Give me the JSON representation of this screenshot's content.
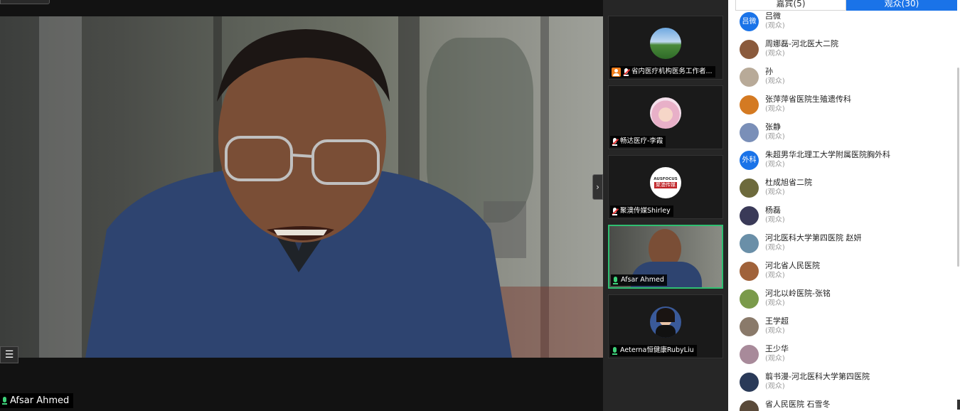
{
  "main": {
    "speaker_name": "Afsar Ahmed",
    "top_button_label": "",
    "list_button_icon": "list-icon",
    "collapse_icon": "chevron-right-icon"
  },
  "thumbnails": [
    {
      "label": "省内医疗机构医务工作者...",
      "host": true,
      "mic": "muted",
      "avatar": "landscape-photo"
    },
    {
      "label": "畅达医疗-李霞",
      "host": false,
      "mic": "muted",
      "avatar": "anime-girl"
    },
    {
      "label": "聚澳传媒Shirley",
      "host": false,
      "mic": "muted",
      "avatar": "logo",
      "logo_top": "AUSFOCUS",
      "logo_bottom": "聚澳传媒"
    },
    {
      "label": "Afsar Ahmed",
      "host": false,
      "mic": "active",
      "avatar": "video",
      "active": true
    },
    {
      "label": "Aeterna恒健康RubyLiu",
      "host": false,
      "mic": "active",
      "avatar": "woman-photo"
    }
  ],
  "panel": {
    "tabs": [
      {
        "label": "嘉宾(5)",
        "active": false
      },
      {
        "label": "观众(30)",
        "active": true
      }
    ],
    "attendees": [
      {
        "name": "吕微",
        "role": "(观众)",
        "avatar_text": "吕微",
        "color": "#1a73e8"
      },
      {
        "name": "周娜磊-河北医大二院",
        "role": "(观众)",
        "avatar_text": "",
        "color": "#8a5a3c"
      },
      {
        "name": "孙",
        "role": "(观众)",
        "avatar_text": "",
        "color": "#b8aa98"
      },
      {
        "name": "张萍萍省医院生殖遗传科",
        "role": "(观众)",
        "avatar_text": "",
        "color": "#d47a22"
      },
      {
        "name": "张静",
        "role": "(观众)",
        "avatar_text": "",
        "color": "#7a8fb8"
      },
      {
        "name": "朱超男华北理工大学附属医院胸外科",
        "role": "(观众)",
        "avatar_text": "外科",
        "color": "#1a73e8"
      },
      {
        "name": "杜成旭省二院",
        "role": "(观众)",
        "avatar_text": "",
        "color": "#6d6a3c"
      },
      {
        "name": "杨磊",
        "role": "(观众)",
        "avatar_text": "",
        "color": "#3a3a58"
      },
      {
        "name": "河北医科大学第四医院 赵妍",
        "role": "(观众)",
        "avatar_text": "",
        "color": "#6a8fa8"
      },
      {
        "name": "河北省人民医院",
        "role": "(观众)",
        "avatar_text": "",
        "color": "#a0623a"
      },
      {
        "name": "河北以岭医院-张铭",
        "role": "(观众)",
        "avatar_text": "",
        "color": "#7a9a4a"
      },
      {
        "name": "王学超",
        "role": "(观众)",
        "avatar_text": "",
        "color": "#8a7a6a"
      },
      {
        "name": "王少华",
        "role": "(观众)",
        "avatar_text": "",
        "color": "#a88a9a"
      },
      {
        "name": "翦书漫-河北医科大学第四医院",
        "role": "(观众)",
        "avatar_text": "",
        "color": "#2a3a58"
      },
      {
        "name": "省人民医院 石雪冬",
        "role": "",
        "avatar_text": "",
        "color": "#5a4a3a"
      }
    ]
  }
}
